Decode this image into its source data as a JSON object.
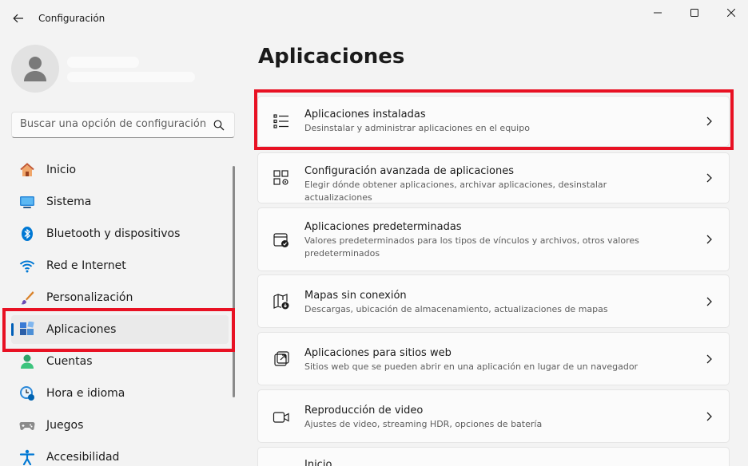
{
  "window": {
    "title": "Configuración",
    "controls": [
      "minimize",
      "maximize",
      "close"
    ]
  },
  "sidebar": {
    "search": {
      "placeholder": "Buscar una opción de configuración"
    },
    "items": [
      {
        "label": "Inicio",
        "icon": "home-icon"
      },
      {
        "label": "Sistema",
        "icon": "monitor-icon"
      },
      {
        "label": "Bluetooth y dispositivos",
        "icon": "bluetooth-icon"
      },
      {
        "label": "Red e Internet",
        "icon": "wifi-icon"
      },
      {
        "label": "Personalización",
        "icon": "brush-icon"
      },
      {
        "label": "Aplicaciones",
        "icon": "apps-icon",
        "selected": true
      },
      {
        "label": "Cuentas",
        "icon": "person-icon"
      },
      {
        "label": "Hora e idioma",
        "icon": "clock-globe-icon"
      },
      {
        "label": "Juegos",
        "icon": "gamepad-icon"
      },
      {
        "label": "Accesibilidad",
        "icon": "accessibility-icon"
      }
    ]
  },
  "main": {
    "title": "Aplicaciones",
    "cards": [
      {
        "title": "Aplicaciones instaladas",
        "description": "Desinstalar y administrar aplicaciones en el equipo",
        "icon": "list-icon"
      },
      {
        "title": "Configuración avanzada de aplicaciones",
        "description": "Elegir dónde obtener aplicaciones, archivar aplicaciones, desinstalar actualizaciones",
        "icon": "apps-gear-icon"
      },
      {
        "title": "Aplicaciones predeterminadas",
        "description": "Valores predeterminados para los tipos de vínculos y archivos, otros valores predeterminados",
        "icon": "default-apps-icon"
      },
      {
        "title": "Mapas sin conexión",
        "description": "Descargas, ubicación de almacenamiento, actualizaciones de mapas",
        "icon": "offline-map-icon"
      },
      {
        "title": "Aplicaciones para sitios web",
        "description": "Sitios web que se pueden abrir en una aplicación en lugar de un navegador",
        "icon": "open-external-icon"
      },
      {
        "title": "Reproducción de video",
        "description": "Ajustes de video, streaming HDR, opciones de batería",
        "icon": "video-camera-icon"
      },
      {
        "title": "Inicio",
        "description": "",
        "icon": ""
      }
    ]
  },
  "colors": {
    "accent": "#005fb8",
    "highlight_box": "#e81123",
    "background": "#f3f3f3",
    "card": "#fbfbfb"
  }
}
